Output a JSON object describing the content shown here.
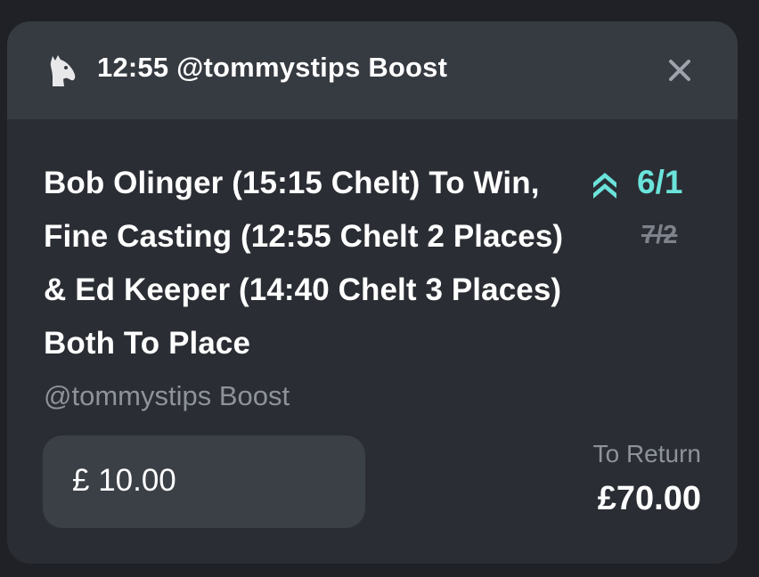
{
  "header": {
    "title": "12:55 @tommystips Boost",
    "icons": {
      "sport": "horse-head-icon",
      "close": "close-icon"
    }
  },
  "selection": {
    "description": "Bob Olinger (15:15 Chelt) To Win, Fine Casting (12:55 Chelt 2 Places) & Ed Keeper (14:40 Chelt 3 Places) Both To Place",
    "subtitle": "@tommystips Boost"
  },
  "odds": {
    "boosted": "6/1",
    "original": "7/2",
    "boost_icon": "double-chevron-up-icon"
  },
  "stake": {
    "value": "£ 10.00"
  },
  "returns": {
    "label": "To Return",
    "value": "£70.00"
  },
  "colors": {
    "background": "#1f2126",
    "card": "#2a2d33",
    "header": "#363a41",
    "input": "#3b3f46",
    "accent": "#6be3db",
    "muted": "#8e939b"
  }
}
